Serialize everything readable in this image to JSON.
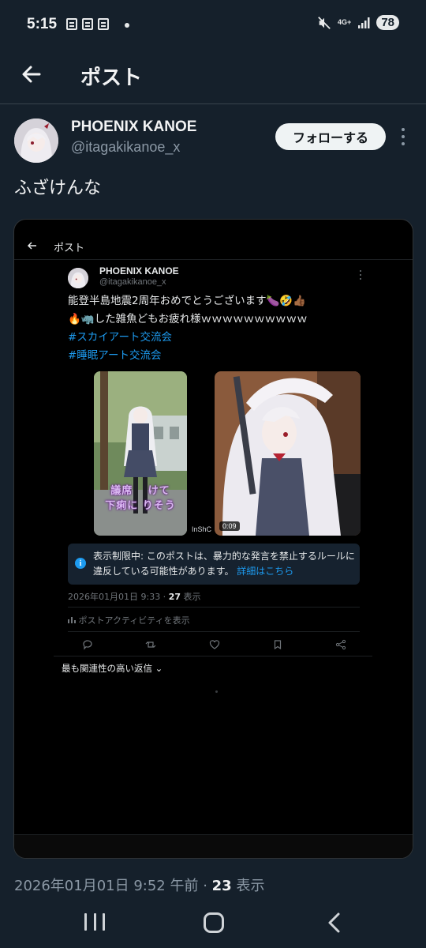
{
  "status_bar": {
    "time": "5:15",
    "network": "4G+",
    "battery": "78"
  },
  "header": {
    "title": "ポスト"
  },
  "post": {
    "author_name": "PHOENIX KANOE",
    "author_handle": "@itagakikanoe_x",
    "follow_label": "フォローする",
    "text": "ふざけんな",
    "timestamp": "2026年01月01日 9:52 午前 · ",
    "view_count": "23",
    "view_label": " 表示"
  },
  "embedded": {
    "header_title": "ポスト",
    "author_name": "PHOENIX KANOE",
    "author_handle": "@itagakikanoe_x",
    "text_line1": "能登半島地震2周年おめでとうございます🍆🤣👍🏾",
    "text_line2": "🔥🦏した雑魚どもお疲れ様ｗｗｗｗｗｗｗｗｗｗ",
    "hashtag1": "#スカイアート交流会",
    "hashtag2": "#睡眠アート交流会",
    "subtitle_line1": "議席　 けて",
    "subtitle_line2": "下痢に りそう",
    "video_duration": "0:09",
    "watermark": "InShC",
    "notice_text": "表示制限中: このポストは、暴力的な発言を禁止するルールに違反している可能性があります。",
    "notice_link": "詳細はこちら",
    "timestamp": "2026年01月01日 9:33 · ",
    "view_count": "27",
    "view_label": " 表示",
    "activity": "ポストアクティビティを表示",
    "replies_sort": "最も関連性の高い返信"
  },
  "colors": {
    "background": "#15202b",
    "accent": "#1d9bf0",
    "secondary_text": "#8b98a5"
  }
}
